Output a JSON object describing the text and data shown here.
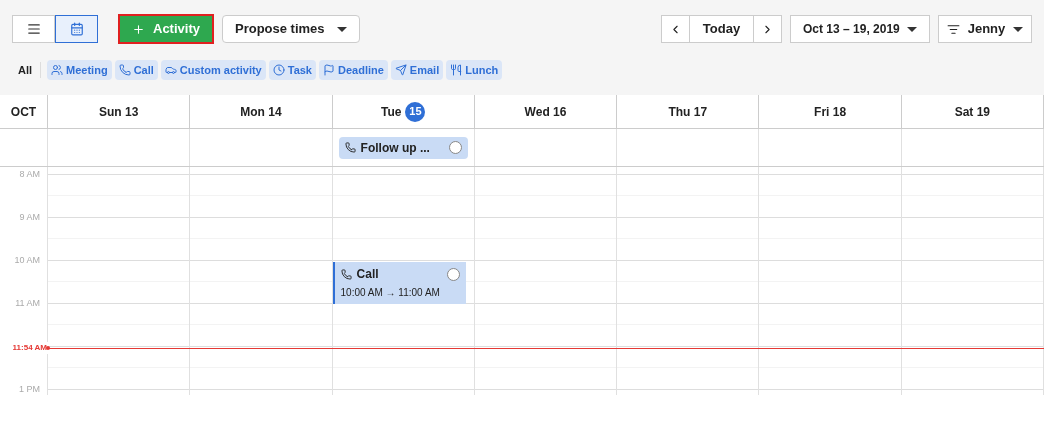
{
  "toolbar": {
    "view_toggle": [
      {
        "kind": "list",
        "selected": false
      },
      {
        "kind": "calendar",
        "selected": true
      }
    ],
    "add_button": "Activity",
    "propose_button": "Propose times",
    "today_button": "Today",
    "date_range": "Oct 13 – 19, 2019",
    "user_filter": "Jenny"
  },
  "filters": {
    "all": "All",
    "chips": [
      {
        "kind": "meeting",
        "label": "Meeting"
      },
      {
        "kind": "call",
        "label": "Call"
      },
      {
        "kind": "custom",
        "label": "Custom activity"
      },
      {
        "kind": "task",
        "label": "Task"
      },
      {
        "kind": "deadline",
        "label": "Deadline"
      },
      {
        "kind": "email",
        "label": "Email"
      },
      {
        "kind": "lunch",
        "label": "Lunch"
      }
    ]
  },
  "calendar": {
    "month": "OCT",
    "days": [
      {
        "name": "Sun 13",
        "today": false
      },
      {
        "name": "Mon 14",
        "today": false
      },
      {
        "name": "Tue",
        "number": "15",
        "today": true,
        "events": [
          {
            "kind": "all_day",
            "title": "Follow up ...",
            "done": false
          },
          {
            "kind": "timed",
            "title": "Call",
            "time": "10:00 AM → 11:00 AM",
            "done": false
          }
        ]
      },
      {
        "name": "Wed 16",
        "today": false
      },
      {
        "name": "Thu 17",
        "today": false
      },
      {
        "name": "Fri 18",
        "today": false
      },
      {
        "name": "Sat 19",
        "today": false
      }
    ],
    "hours": [
      {
        "kind": "hour",
        "label": "8 AM"
      },
      {
        "kind": "hour",
        "label": "9 AM"
      },
      {
        "kind": "hour",
        "label": "10 AM"
      },
      {
        "kind": "hour",
        "label": "11 AM"
      },
      {
        "kind": "now",
        "label": "11:54 AM"
      },
      {
        "kind": "hour",
        "label": "1 PM"
      }
    ]
  }
}
